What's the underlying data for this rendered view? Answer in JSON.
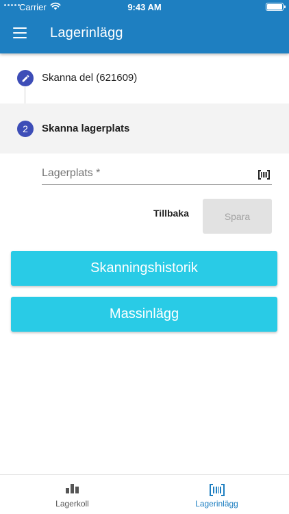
{
  "status_bar": {
    "carrier": "Carrier",
    "time": "9:43 AM"
  },
  "header": {
    "title": "Lagerinlägg"
  },
  "stepper": {
    "steps": [
      {
        "label": "Skanna del (621609)",
        "icon": "pencil-icon",
        "state": "completed"
      },
      {
        "number": "2",
        "label": "Skanna lagerplats",
        "state": "active"
      }
    ]
  },
  "form": {
    "location_placeholder": "Lagerplats *",
    "location_value": "",
    "back_label": "Tillbaka",
    "save_label": "Spara"
  },
  "actions": {
    "history_label": "Skanningshistorik",
    "mass_label": "Massinlägg"
  },
  "tabbar": {
    "tabs": [
      {
        "label": "Lagerkoll",
        "icon": "bar-chart-icon",
        "active": false
      },
      {
        "label": "Lagerinlägg",
        "icon": "barcode-icon",
        "active": true
      }
    ]
  },
  "colors": {
    "header": "#1e7fc1",
    "step_icon": "#3d4db7",
    "action_button": "#29cbe6",
    "active_tab": "#1e7fc1"
  }
}
